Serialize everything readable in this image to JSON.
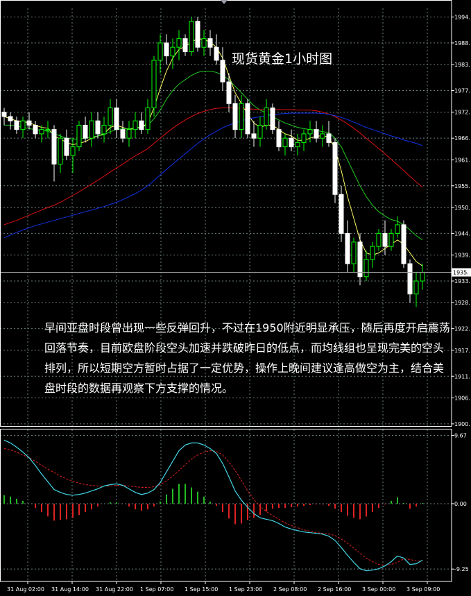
{
  "title": "现货黄金1小时图",
  "commentary": "早间亚盘时段曾出现一些反弹回升，不过在1950附近明显承压，随后再度开启震荡回落节奏，目前欧盘阶段空头加速并跌破昨日的低点，而均线组也呈现完美的空头排列，所以短期空方暂时占据了一定优势，操作上晚间建议逢高做空为主，结合美盘时段的数据再观察下方支撑的情况。",
  "colors": {
    "background": "#000000",
    "bull_candle": "#00ff00",
    "bear_candle": "#ffffff",
    "ma_fast": "#ffff66",
    "ma_mid": "#22cc22",
    "ma_slow": "#dd1111",
    "ma_long": "#1133ee",
    "macd_line": "#44d9e8",
    "signal_line": "#dd2222",
    "hist_pos": "#22bb22",
    "hist_neg": "#dd2222",
    "grid": "#6e7f80",
    "current_price_line": "#a0a0a0"
  },
  "chart_data": [
    {
      "type": "candlestick",
      "title": "现货黄金1小时图",
      "x_tick_labels": [
        "31 Aug 02:00",
        "31 Aug 14:00",
        "31 Aug 22:00",
        "1 Sep 07:00",
        "1 Sep 15:00",
        "1 Sep 23:00",
        "2 Sep 08:00",
        "2 Sep 16:00",
        "3 Sep 00:00",
        "3 Sep 09:00"
      ],
      "y_tick_labels": [
        "1994.",
        "1988.",
        "1983.",
        "1977.",
        "1972.",
        "1966.",
        "1961.",
        "1955.",
        "1950.",
        "1944.",
        "1939.",
        "1933.",
        "1928.",
        "1922.",
        "1917.",
        "1911.",
        "1906.",
        "1900."
      ],
      "y_ticks": [
        1994,
        1988,
        1983,
        1977,
        1972,
        1966,
        1961,
        1955,
        1950,
        1944,
        1939,
        1933,
        1928,
        1922,
        1917,
        1911,
        1906,
        1900
      ],
      "ylim": [
        1899.5,
        1996
      ],
      "current_price": 1935,
      "current_price_label": "1935.",
      "candles": [
        [
          1972,
          1973,
          1969,
          1971
        ],
        [
          1971,
          1972,
          1968,
          1970
        ],
        [
          1970,
          1971,
          1967,
          1968
        ],
        [
          1968,
          1971,
          1966,
          1970
        ],
        [
          1970,
          1972,
          1968,
          1969
        ],
        [
          1969,
          1970,
          1966,
          1967
        ],
        [
          1967,
          1969,
          1965,
          1968
        ],
        [
          1968,
          1970,
          1966,
          1968
        ],
        [
          1968,
          1969,
          1956,
          1960
        ],
        [
          1960,
          1967,
          1958,
          1966
        ],
        [
          1966,
          1968,
          1961,
          1962
        ],
        [
          1962,
          1966,
          1958,
          1964
        ],
        [
          1964,
          1970,
          1963,
          1969
        ],
        [
          1969,
          1971,
          1965,
          1966
        ],
        [
          1966,
          1972,
          1964,
          1970
        ],
        [
          1970,
          1972,
          1966,
          1967
        ],
        [
          1967,
          1971,
          1965,
          1969
        ],
        [
          1969,
          1975,
          1967,
          1973
        ],
        [
          1973,
          1975,
          1966,
          1968
        ],
        [
          1968,
          1970,
          1965,
          1966
        ],
        [
          1966,
          1970,
          1964,
          1968
        ],
        [
          1968,
          1972,
          1966,
          1970
        ],
        [
          1970,
          1972,
          1967,
          1968
        ],
        [
          1968,
          1975,
          1967,
          1973
        ],
        [
          1973,
          1985,
          1971,
          1984
        ],
        [
          1984,
          1990,
          1981,
          1988
        ],
        [
          1988,
          1990,
          1983,
          1985
        ],
        [
          1985,
          1989,
          1982,
          1987
        ],
        [
          1987,
          1991,
          1984,
          1989
        ],
        [
          1989,
          1990,
          1985,
          1986
        ],
        [
          1986,
          1994,
          1985,
          1993
        ],
        [
          1993,
          1994,
          1986,
          1987
        ],
        [
          1987,
          1991,
          1985,
          1989
        ],
        [
          1989,
          1991,
          1985,
          1987
        ],
        [
          1987,
          1990,
          1983,
          1984
        ],
        [
          1984,
          1987,
          1977,
          1979
        ],
        [
          1979,
          1981,
          1972,
          1974
        ],
        [
          1974,
          1976,
          1966,
          1968
        ],
        [
          1968,
          1976,
          1966,
          1974
        ],
        [
          1974,
          1975,
          1966,
          1967
        ],
        [
          1967,
          1970,
          1964,
          1966
        ],
        [
          1966,
          1971,
          1964,
          1969
        ],
        [
          1969,
          1975,
          1968,
          1973
        ],
        [
          1973,
          1974,
          1967,
          1968
        ],
        [
          1968,
          1970,
          1963,
          1964
        ],
        [
          1964,
          1967,
          1962,
          1966
        ],
        [
          1966,
          1968,
          1963,
          1964
        ],
        [
          1964,
          1967,
          1962,
          1965
        ],
        [
          1965,
          1968,
          1963,
          1967
        ],
        [
          1967,
          1970,
          1965,
          1968
        ],
        [
          1968,
          1970,
          1965,
          1966
        ],
        [
          1966,
          1969,
          1964,
          1967
        ],
        [
          1967,
          1970,
          1964,
          1965
        ],
        [
          1965,
          1966,
          1951,
          1953
        ],
        [
          1953,
          1955,
          1942,
          1944
        ],
        [
          1944,
          1947,
          1935,
          1937
        ],
        [
          1937,
          1943,
          1935,
          1942
        ],
        [
          1942,
          1944,
          1932,
          1934
        ],
        [
          1934,
          1940,
          1933,
          1938
        ],
        [
          1938,
          1942,
          1936,
          1941
        ],
        [
          1941,
          1945,
          1940,
          1944
        ],
        [
          1944,
          1947,
          1939,
          1941
        ],
        [
          1941,
          1945,
          1940,
          1944
        ],
        [
          1944,
          1948,
          1943,
          1946
        ],
        [
          1946,
          1947,
          1936,
          1937
        ],
        [
          1937,
          1938,
          1928,
          1930
        ],
        [
          1930,
          1935,
          1927,
          1933
        ],
        [
          1933,
          1937,
          1931,
          1935
        ]
      ],
      "moving_averages": [
        {
          "values": [
            1971,
            1970.5,
            1970,
            1969.8,
            1969.6,
            1969,
            1968.5,
            1968.3,
            1966.5,
            1965.8,
            1965,
            1964.5,
            1964.8,
            1965.2,
            1966,
            1966.5,
            1967,
            1968.5,
            1969,
            1968.5,
            1968,
            1968.3,
            1968.5,
            1969.5,
            1973,
            1977.5,
            1981.5,
            1984.5,
            1986.5,
            1987.2,
            1988.2,
            1989,
            1988.8,
            1988.2,
            1987,
            1984.5,
            1980.5,
            1976.5,
            1974,
            1971.5,
            1969.5,
            1968.5,
            1969,
            1969,
            1968,
            1967,
            1966.5,
            1965.5,
            1965.5,
            1966,
            1966.5,
            1966.5,
            1966.3,
            1963.5,
            1958.5,
            1952.5,
            1947.5,
            1942.5,
            1939.5,
            1939,
            1939.5,
            1940.5,
            1941.5,
            1942.5,
            1941.5,
            1939.5,
            1937.5,
            1936.5
          ]
        },
        {
          "values": [
            1969,
            1969,
            1968.8,
            1968.5,
            1968.2,
            1968,
            1967.8,
            1967.6,
            1967,
            1966.5,
            1966,
            1965.8,
            1965.8,
            1966,
            1966.3,
            1966.5,
            1966.8,
            1967.5,
            1968,
            1968.2,
            1968.2,
            1968.4,
            1968.6,
            1969,
            1970.5,
            1972.5,
            1975,
            1977,
            1978.5,
            1979.5,
            1980.5,
            1981.2,
            1981.5,
            1981.5,
            1981.2,
            1980.5,
            1979.5,
            1978,
            1976.5,
            1975,
            1973.5,
            1972.5,
            1971.8,
            1971,
            1970.2,
            1969.5,
            1969,
            1968.5,
            1968.2,
            1968,
            1967.8,
            1967.5,
            1967.3,
            1966,
            1964,
            1961,
            1958,
            1955,
            1952.5,
            1950.5,
            1949,
            1948,
            1947.2,
            1946.8,
            1946,
            1944.8,
            1943.5,
            1942.5
          ]
        },
        {
          "values": [
            1946,
            1946.5,
            1947,
            1947.6,
            1948.2,
            1948.8,
            1949.4,
            1950,
            1950.5,
            1951.2,
            1952,
            1952.8,
            1953.6,
            1954.5,
            1955.4,
            1956.3,
            1957.2,
            1958.2,
            1959.1,
            1960,
            1961,
            1961.9,
            1962.7,
            1963.6,
            1964.8,
            1966,
            1967.2,
            1968.3,
            1969.3,
            1970.2,
            1971,
            1971.7,
            1972.2,
            1972.6,
            1972.9,
            1973,
            1973,
            1973,
            1972.9,
            1972.8,
            1972.7,
            1972.6,
            1972.6,
            1972.6,
            1972.6,
            1972.6,
            1972.6,
            1972.5,
            1972.5,
            1972.5,
            1972.3,
            1972,
            1971.6,
            1971,
            1970.2,
            1969.3,
            1968.3,
            1967.2,
            1966,
            1964.8,
            1963.6,
            1962.4,
            1961.1,
            1959.8,
            1958.5,
            1957.2,
            1955.9,
            1954.7
          ]
        },
        {
          "values": [
            1943,
            1943.6,
            1944.2,
            1944.8,
            1945.3,
            1945.8,
            1946.2,
            1946.6,
            1947,
            1947.4,
            1947.8,
            1948.2,
            1948.6,
            1949,
            1949.4,
            1949.8,
            1950.2,
            1950.7,
            1951.2,
            1951.8,
            1952.5,
            1953.2,
            1954,
            1955,
            1956.2,
            1957.5,
            1958.8,
            1960,
            1961.2,
            1962.4,
            1963.6,
            1964.8,
            1965.8,
            1966.8,
            1967.6,
            1968.4,
            1969,
            1969.5,
            1970,
            1970.4,
            1970.7,
            1971,
            1971.2,
            1971.4,
            1971.6,
            1971.7,
            1971.8,
            1971.8,
            1971.8,
            1971.8,
            1971.8,
            1971.7,
            1971.5,
            1971.2,
            1970.8,
            1970.3,
            1969.7,
            1969.1,
            1968.5,
            1968,
            1967.5,
            1967,
            1966.5,
            1966.1,
            1965.6,
            1965.2,
            1964.8,
            1964.3
          ]
        }
      ]
    },
    {
      "type": "macd",
      "y_tick_labels": [
        "9.67",
        "0.00",
        "-9.25"
      ],
      "y_ticks": [
        9.67,
        0,
        -9.25
      ],
      "ylim": [
        -11,
        10.5
      ],
      "macd": [
        9,
        8.6,
        8,
        7.3,
        6.5,
        5.4,
        4.2,
        3.1,
        2,
        1.6,
        1.3,
        1.2,
        1.3,
        1.5,
        1.8,
        2.1,
        2.5,
        2.7,
        2.8,
        2.6,
        2.1,
        1.6,
        1.3,
        1.5,
        2,
        3,
        4.5,
        6,
        7.5,
        8.3,
        8.6,
        8.6,
        8.3,
        7.8,
        7.1,
        5.7,
        3.8,
        1.8,
        0.5,
        -0.5,
        -1.4,
        -2,
        -2.2,
        -2.4,
        -2.8,
        -3.3,
        -3.6,
        -3.8,
        -4,
        -4.1,
        -4.2,
        -4.3,
        -4.6,
        -5.2,
        -6.2,
        -7.3,
        -8.3,
        -9.2,
        -9.5,
        -9.4,
        -9.2,
        -8.8,
        -8.2,
        -7.4,
        -7.7,
        -8.6,
        -8.5,
        -8
      ],
      "signal": [
        7.8,
        7.6,
        7.3,
        6.9,
        6.5,
        6,
        5.4,
        4.9,
        4.4,
        3.9,
        3.5,
        3.2,
        2.9,
        2.7,
        2.6,
        2.5,
        2.5,
        2.5,
        2.6,
        2.6,
        2.5,
        2.4,
        2.3,
        2.3,
        2.4,
        2.7,
        3.2,
        3.9,
        4.7,
        5.5,
        6.3,
        6.9,
        7.3,
        7.5,
        7.4,
        6.9,
        5.9,
        4.7,
        3.3,
        1.8,
        0.6,
        -0.4,
        -1.1,
        -1.7,
        -2.2,
        -2.7,
        -3.1,
        -3.4,
        -3.7,
        -3.9,
        -4.1,
        -4.2,
        -4.3,
        -4.5,
        -5,
        -5.6,
        -6.3,
        -7,
        -7.7,
        -8.2,
        -8.6,
        -8.7,
        -8.6,
        -8.3,
        -7.8,
        -7.9,
        -8.1,
        -8.1
      ],
      "histogram": [
        1.2,
        1,
        0.7,
        0.4,
        0,
        -0.6,
        -1.2,
        -1.8,
        -2.4,
        -2.3,
        -2.2,
        -2,
        -1.6,
        -1.2,
        -0.8,
        -0.4,
        0,
        0.2,
        0.2,
        0,
        -0.4,
        -0.8,
        -1,
        -0.8,
        -0.4,
        0.3,
        1.3,
        2.1,
        2.8,
        2.8,
        2.3,
        1.7,
        1,
        0.3,
        -0.3,
        -1.2,
        -2.1,
        -2.9,
        -2.8,
        -2.3,
        -2,
        -1.6,
        -1.1,
        -0.7,
        -0.6,
        -0.6,
        -0.5,
        -0.4,
        -0.3,
        -0.2,
        -0.1,
        -0.1,
        -0.3,
        -0.7,
        -1.2,
        -1.7,
        -2,
        -2.2,
        -1.8,
        -1.2,
        -0.6,
        -0.1,
        0.4,
        0.9,
        0.1,
        -0.7,
        -0.4,
        0.1
      ]
    }
  ]
}
